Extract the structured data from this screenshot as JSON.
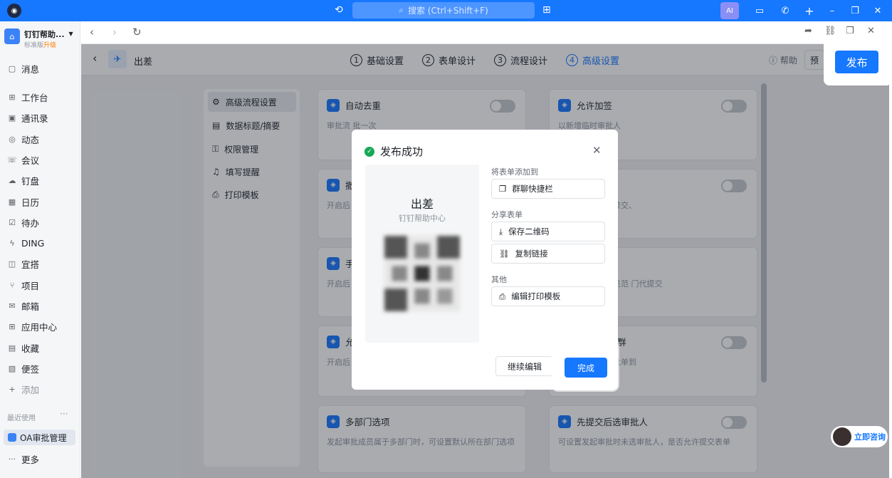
{
  "titlebar": {
    "search_placeholder": "搜索 (Ctrl+Shift+F)",
    "accent": "#1677ff",
    "ai_label": "AI"
  },
  "sidebar": {
    "org_name": "钉钉帮助...",
    "org_edition": "标准版",
    "org_upgrade": "升级",
    "items": [
      {
        "label": "消息",
        "icon": "message-icon"
      },
      {
        "label": "工作台",
        "icon": "workbench-icon"
      },
      {
        "label": "通讯录",
        "icon": "contacts-icon"
      },
      {
        "label": "动态",
        "icon": "feed-icon"
      },
      {
        "label": "会议",
        "icon": "meeting-icon"
      },
      {
        "label": "钉盘",
        "icon": "drive-icon"
      },
      {
        "label": "日历",
        "icon": "calendar-icon"
      },
      {
        "label": "待办",
        "icon": "todo-icon"
      },
      {
        "label": "DING",
        "icon": "ding-icon"
      },
      {
        "label": "宜搭",
        "icon": "yida-icon"
      },
      {
        "label": "项目",
        "icon": "project-icon"
      },
      {
        "label": "邮箱",
        "icon": "mail-icon"
      },
      {
        "label": "应用中心",
        "icon": "apps-icon"
      },
      {
        "label": "收藏",
        "icon": "favorite-icon"
      },
      {
        "label": "便签",
        "icon": "note-icon"
      },
      {
        "label": "添加",
        "icon": "plus-icon"
      }
    ],
    "recent_title": "最近使用",
    "recent_item": "OA审批管理",
    "more": "更多"
  },
  "header": {
    "form_title": "出差",
    "steps": [
      {
        "num": "1",
        "label": "基础设置"
      },
      {
        "num": "2",
        "label": "表单设计"
      },
      {
        "num": "3",
        "label": "流程设计"
      },
      {
        "num": "4",
        "label": "高级设置"
      }
    ],
    "active_step": 4,
    "help": "帮助",
    "preview": "预",
    "publish": "发布"
  },
  "leftmenu": [
    {
      "label": "高级流程设置",
      "icon": "gear-icon"
    },
    {
      "label": "数据标题/摘要",
      "icon": "document-icon"
    },
    {
      "label": "权限管理",
      "icon": "lock-icon"
    },
    {
      "label": "填写提醒",
      "icon": "bell-icon"
    },
    {
      "label": "打印模板",
      "icon": "printer-icon"
    }
  ],
  "cards": [
    {
      "title": "自动去重",
      "desc": "审批流 批一次"
    },
    {
      "title": "允许加签",
      "desc": "以新增临时审批人"
    },
    {
      "title": "撤",
      "desc": "开启后"
    },
    {
      "title": "",
      "desc": "期，自动提醒、转交、"
    },
    {
      "title": "手",
      "desc": "开启后 批"
    },
    {
      "title": "",
      "desc": "否必填、评语可见范 门代提交"
    },
    {
      "title": "允",
      "desc": "开启后"
    },
    {
      "title": "群",
      "desc": "选择是否同步审批单到"
    },
    {
      "title": "多部门选项",
      "desc": "发起审批成员属于多部门时，可设置默认所在部门选项"
    },
    {
      "title": "先提交后选审批人",
      "desc": "可设置发起审批时未选审批人，是否允许提交表单"
    }
  ],
  "modal": {
    "title": "发布成功",
    "qr_title": "出差",
    "qr_sub": "钉钉帮助中心",
    "add_label": "将表单添加到",
    "add_btn": "群聊快捷栏",
    "share_label": "分享表单",
    "save_qr": "保存二维码",
    "copy_link": "复制链接",
    "other_label": "其他",
    "edit_print": "编辑打印模板",
    "continue": "继续编辑",
    "done": "完成"
  },
  "consult": "立即咨询"
}
